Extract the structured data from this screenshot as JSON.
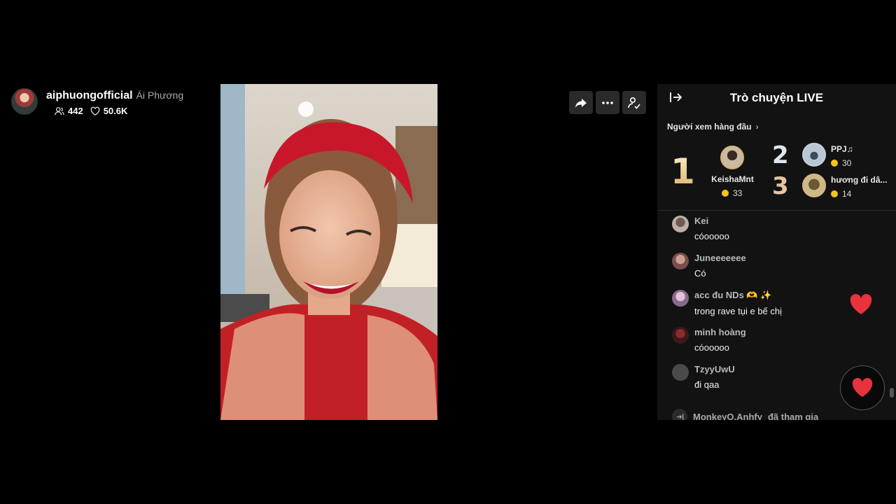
{
  "host": {
    "handle": "aiphuongofficial",
    "display_name": "Ái Phương",
    "viewers": "442",
    "likes": "50.6K"
  },
  "icons": {
    "viewers": "people-icon",
    "likes": "heart-outline-icon",
    "share": "share-icon",
    "more": "more-icon",
    "profile": "user-check-icon",
    "collapse": "collapse-panel-icon",
    "heart": "heart-icon",
    "join": "enter-icon"
  },
  "colors": {
    "accent_heart": "#e8323c",
    "coin": "#f4c51c",
    "panel_bg": "#121212"
  },
  "chat": {
    "title": "Trò chuyện LIVE",
    "top_viewers_label": "Người xem hàng đầu",
    "top_viewers": [
      {
        "rank": "1",
        "name": "KeishaMnt",
        "coins": "33"
      },
      {
        "rank": "2",
        "name": "PPJ♫",
        "coins": "30"
      },
      {
        "rank": "3",
        "name": "hương đi dâ...",
        "coins": "14"
      }
    ],
    "messages": [
      {
        "user": "Kei",
        "text": "cóooooo"
      },
      {
        "user": "Juneeeeeee",
        "text": "Có"
      },
      {
        "user": "acc đu NDs 🫶 ✨",
        "text": "trong rave tụi e bế chị"
      },
      {
        "user": "minh hoàng",
        "text": "cóooooo"
      },
      {
        "user": "TzyyUwU",
        "text": "đi qaa"
      }
    ],
    "join_notice_user": "MonkeyO.Anhfy",
    "join_notice_text": "đã tham gia"
  }
}
